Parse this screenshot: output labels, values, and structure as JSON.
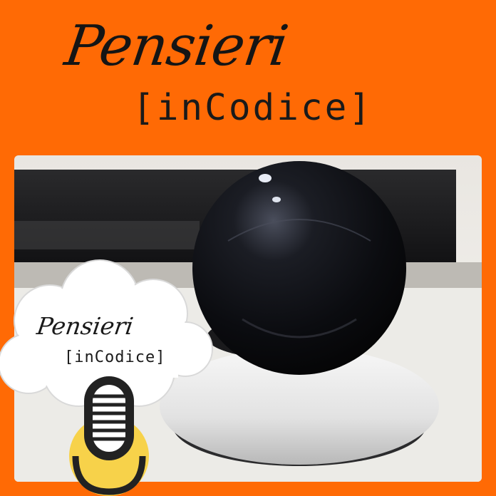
{
  "title": {
    "script": "Pensieri",
    "mono": "[inCodice]"
  },
  "badge": {
    "script": "Pensieri",
    "mono": "[inCodice]"
  },
  "icons": [
    "microphone-icon"
  ],
  "colors": {
    "background": "#ff6a05",
    "text": "#1a1a1a",
    "mic_circle": "#f7d24a",
    "mic_body": "#222222"
  }
}
